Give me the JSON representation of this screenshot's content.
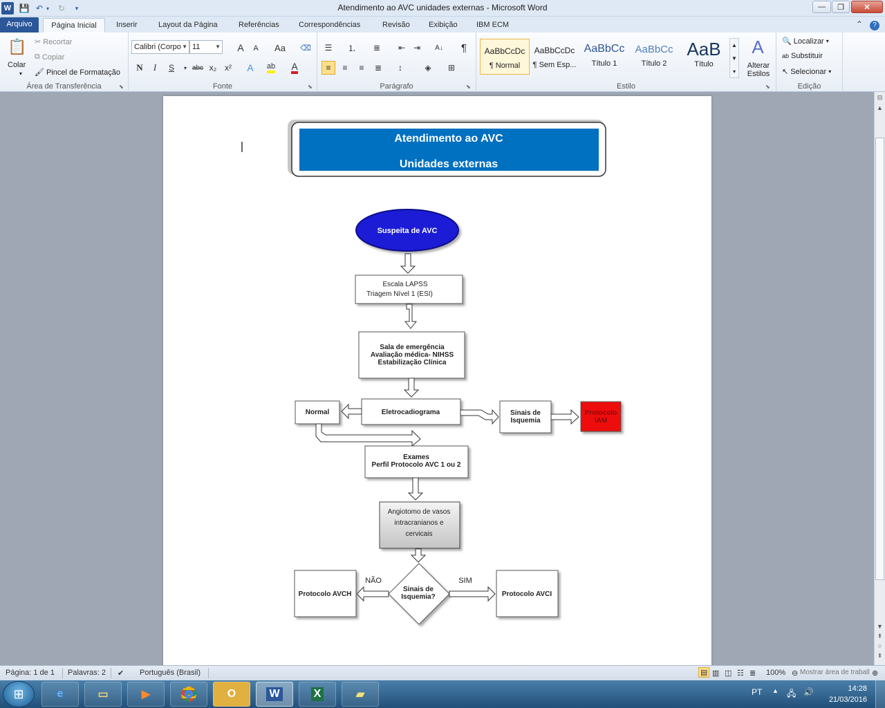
{
  "window": {
    "app_icon": "W",
    "title": "Atendimento ao AVC unidades externas - Microsoft Word",
    "minimize": "—",
    "maximize": "❐",
    "close": "✕"
  },
  "tabs": [
    "Arquivo",
    "Página Inicial",
    "Inserir",
    "Layout da Página",
    "Referências",
    "Correspondências",
    "Revisão",
    "Exibição",
    "IBM ECM"
  ],
  "ribbon": {
    "clipboard": {
      "paste": "Colar",
      "cut": "Recortar",
      "copy": "Copiar",
      "format_painter": "Pincel de Formatação",
      "label": "Área de Transferência"
    },
    "font": {
      "name": "Calibri (Corpo",
      "size": "11",
      "bold": "N",
      "italic": "I",
      "underline": "S",
      "strike": "abc",
      "sub": "x₂",
      "sup": "x²",
      "change_case": "Aa",
      "grow": "A",
      "shrink": "A",
      "label": "Fonte"
    },
    "paragraph": {
      "label": "Parágrafo",
      "pilcrow": "¶"
    },
    "styles": {
      "items": [
        {
          "sample": "AaBbCcDc",
          "name": "¶ Normal"
        },
        {
          "sample": "AaBbCcDc",
          "name": "¶ Sem Esp..."
        },
        {
          "sample": "AaBbCc",
          "name": "Título 1"
        },
        {
          "sample": "AaBbCc",
          "name": "Título 2"
        },
        {
          "sample": "AaB",
          "name": "Título"
        }
      ],
      "change": "Alterar Estilos",
      "label": "Estilo"
    },
    "editing": {
      "find": "Localizar",
      "replace": "Substituir",
      "select": "Selecionar",
      "label": "Edição"
    }
  },
  "document": {
    "header_line1": "Atendimento ao AVC",
    "header_line2": "Unidades externas",
    "flow": {
      "suspeita": "Suspeita de AVC",
      "lapss_1": "Escala LAPSS",
      "lapss_2": "Triagem Nível 1 (ESI)",
      "sala_1": "Sala de emergência",
      "sala_2": "Avaliação médica- NIHSS",
      "sala_3": "Estabilização Clínica",
      "eletro": "Eletrocadiograma",
      "normal": "Normal",
      "sinais_1": "Sinais de",
      "sinais_2": "Isquemia",
      "iam_1": "Protocolo",
      "iam_2": "IAM",
      "exames_1": "Exames",
      "exames_2": "Perfil Protocolo AVC 1 ou 2",
      "angio_1": "Angiotomo de vasos",
      "angio_2": "intracranianos e",
      "angio_3": "cervicais",
      "decision_1": "Sinais de",
      "decision_2": "Isquemia?",
      "nao": "NÃO",
      "sim": "SIM",
      "avch": "Protocolo AVCH",
      "avci": "Protocolo AVCI"
    }
  },
  "status": {
    "page": "Página: 1 de 1",
    "words": "Palavras: 2",
    "language": "Português (Brasil)",
    "zoom": "100%",
    "zoom_hint": "Mostrar área de trabalho"
  },
  "taskbar": {
    "language": "PT",
    "time": "14:28",
    "date": "21/03/2016"
  },
  "colors": {
    "header_blue": "#0070c0",
    "ellipse_blue": "#1f1fd6",
    "iam_red": "#ee1111",
    "word_blue": "#2b579a"
  }
}
